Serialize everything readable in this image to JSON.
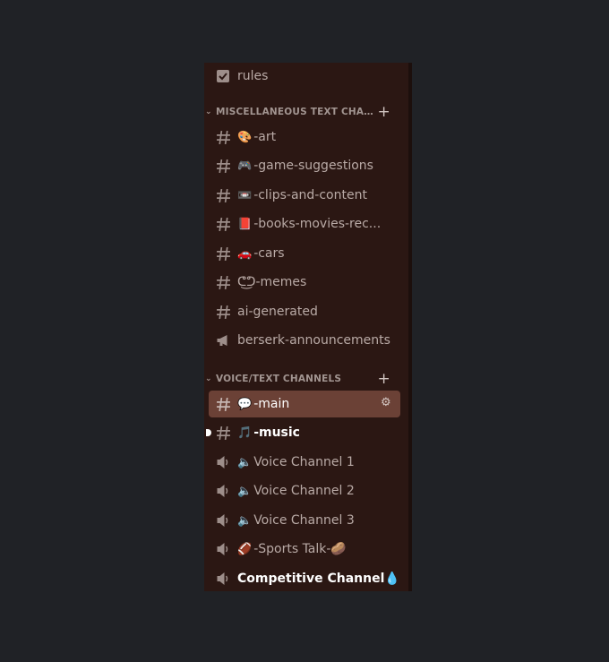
{
  "sidebar": {
    "top_channel": {
      "label": "rules",
      "icon": "rules-checkbox-icon"
    },
    "categories": [
      {
        "label": "MISCELLANEOUS TEXT CHANN...",
        "channels": [
          {
            "emoji": "🎨",
            "label": "-art",
            "icon": "hashtag-icon"
          },
          {
            "emoji": "🎮",
            "label": "-game-suggestions",
            "icon": "hashtag-icon"
          },
          {
            "emoji": "📼",
            "label": "-clips-and-content",
            "icon": "hashtag-icon"
          },
          {
            "emoji": "📕",
            "label": "-books-movies-rec...",
            "icon": "hashtag-icon"
          },
          {
            "emoji": "🚗",
            "label": "-cars",
            "icon": "hashtag-icon"
          },
          {
            "emoji": "",
            "label": "ᕦ͜ᕤ-memes",
            "icon": "hashtag-icon"
          },
          {
            "emoji": "",
            "label": "ai-generated",
            "icon": "hashtag-icon"
          },
          {
            "emoji": "",
            "label": "berserk-announcements",
            "icon": "megaphone-icon"
          }
        ]
      },
      {
        "label": "VOICE/TEXT CHANNELS",
        "channels": [
          {
            "emoji": "💬",
            "label": "-main",
            "icon": "hashtag-icon",
            "selected": true
          },
          {
            "emoji": "🎵",
            "label": "-music",
            "icon": "hashtag-icon",
            "unread": true
          },
          {
            "emoji": "🔈",
            "label": "Voice Channel 1",
            "icon": "speaker-icon"
          },
          {
            "emoji": "🔈",
            "label": "Voice Channel 2",
            "icon": "speaker-icon"
          },
          {
            "emoji": "🔈",
            "label": "Voice Channel 3",
            "icon": "speaker-icon"
          },
          {
            "emoji": "🏈",
            "label": "-Sports Talk-🥔",
            "icon": "speaker-icon"
          },
          {
            "emoji": "",
            "label": "Competitive Channel💧",
            "icon": "speaker-icon",
            "bright": true
          }
        ]
      }
    ]
  },
  "colors": {
    "background": "#202226",
    "sidebar": "#2b1713",
    "selected": "#6b4136",
    "muted_text": "#b9aaa6"
  }
}
